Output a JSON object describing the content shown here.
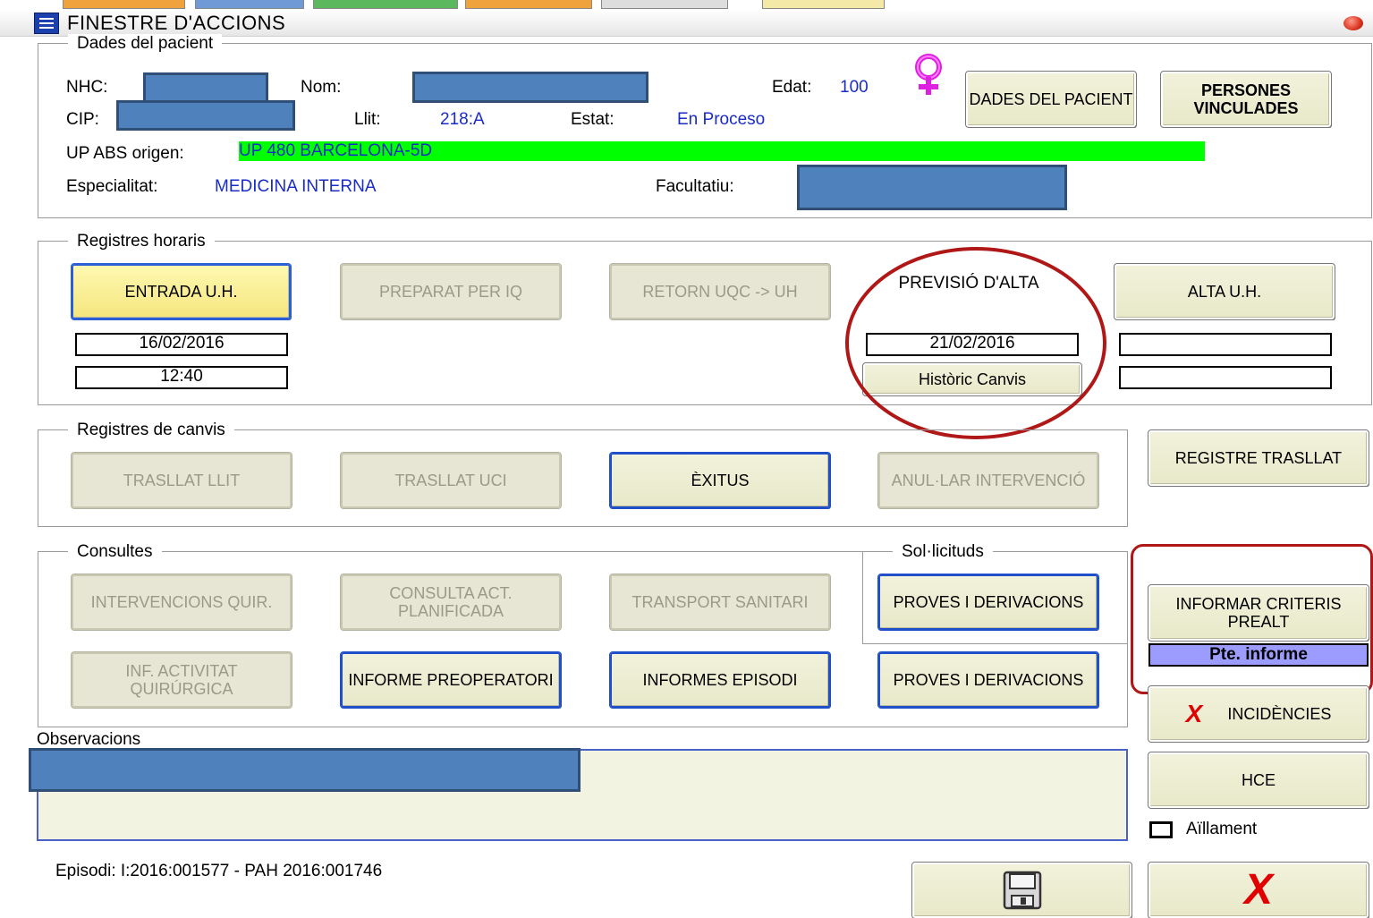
{
  "window": {
    "title": "FINESTRE D'ACCIONS"
  },
  "patient": {
    "legend": "Dades del pacient",
    "nhc_label": "NHC:",
    "nom_label": "Nom:",
    "edat_label": "Edat:",
    "edat_value": "100",
    "cip_label": "CIP:",
    "llit_label": "Llit:",
    "llit_value": "218:A",
    "estat_label": "Estat:",
    "estat_value": "En Proceso",
    "up_label": "UP ABS origen:",
    "up_value": "UP 480 BARCELONA-5D",
    "especialitat_label": "Especialitat:",
    "especialitat_value": "MEDICINA INTERNA",
    "facultatiu_label": "Facultatiu:",
    "dades_button": "DADES DEL PACIENT",
    "persones_button": "PERSONES VINCULADES"
  },
  "registres_horaris": {
    "legend": "Registres horaris",
    "entrada_button": "ENTRADA U.H.",
    "preparat_button": "PREPARAT PER IQ",
    "retorn_button": "RETORN UQC -> UH",
    "previsio_label": "PREVISIÓ D'ALTA",
    "alta_button": "ALTA U.H.",
    "entrada_date": "16/02/2016",
    "entrada_time": "12:40",
    "previsio_date": "21/02/2016",
    "historic_button": "Històric Canvis",
    "alta_date": "",
    "alta_time": ""
  },
  "registres_canvis": {
    "legend": "Registres de canvis",
    "trasllat_llit": "TRASLLAT LLIT",
    "trasllat_uci": "TRASLLAT UCI",
    "exitus": "ÈXITUS",
    "anular": "ANUL·LAR INTERVENCIÓ"
  },
  "side": {
    "registre_trasllat": "REGISTRE TRASLLAT",
    "informar_criteris": "INFORMAR CRITERIS PREALT",
    "pte_informe": "Pte. informe",
    "incidencies": "INCIDÈNCIES",
    "hce": "HCE",
    "aillament": "Aïllament",
    "cancel_glyph": "X"
  },
  "consultes": {
    "legend": "Consultes",
    "intervencions": "INTERVENCIONS QUIR.",
    "consulta_act": "CONSULTA ACT. PLANIFICADA",
    "transport": "TRANSPORT SANITARI",
    "inf_activitat": "INF. ACTIVITAT QUIRÚRGICA",
    "informe_preop": "INFORME PREOPERATORI",
    "informes_episodi": "INFORMES EPISODI"
  },
  "sollicituds": {
    "legend": "Sol·licituds",
    "proves1": "PROVES I DERIVACIONS",
    "proves2": "PROVES I DERIVACIONS"
  },
  "observacions": {
    "label": "Observacions"
  },
  "footer": {
    "episodi": "Episodi: I:2016:001577 - PAH 2016:001746"
  },
  "colors": {
    "accent_blue": "#1a2cc8",
    "up_highlight": "#00ff00",
    "annotation_red": "#b01818",
    "pte_bg": "#9c9cff"
  }
}
